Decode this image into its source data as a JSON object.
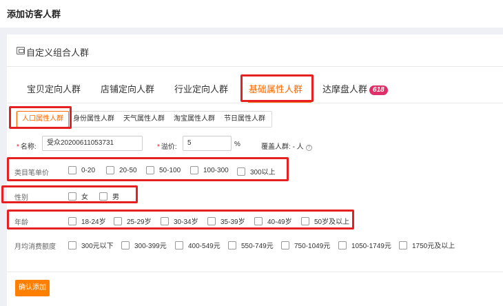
{
  "page": {
    "title": "添加访客人群"
  },
  "card": {
    "title": "自定义组合人群"
  },
  "main_tabs": [
    {
      "label": "宝贝定向人群"
    },
    {
      "label": "店铺定向人群"
    },
    {
      "label": "行业定向人群"
    },
    {
      "label": "基础属性人群",
      "active": true
    },
    {
      "label": "达摩盘人群",
      "badge": "618"
    }
  ],
  "sub_tabs": [
    {
      "label": "人口属性人群",
      "active": true
    },
    {
      "label": "身份属性人群"
    },
    {
      "label": "天气属性人群"
    },
    {
      "label": "淘宝属性人群"
    },
    {
      "label": "节日属性人群"
    }
  ],
  "form": {
    "name_label": "名称:",
    "name_value": "受众20200611053731",
    "premium_label": "溢价:",
    "premium_value": "5",
    "premium_unit": "%",
    "coverage_label": "覆盖人群:",
    "coverage_value": "- 人",
    "help_icon": "?"
  },
  "rows": {
    "category_price": {
      "label": "类目笔单价",
      "options": [
        "0-20",
        "20-50",
        "50-100",
        "100-300",
        "300以上"
      ]
    },
    "gender": {
      "label": "性别",
      "options": [
        "女",
        "男"
      ]
    },
    "age": {
      "label": "年龄",
      "options": [
        "18-24岁",
        "25-29岁",
        "30-34岁",
        "35-39岁",
        "40-49岁",
        "50岁及以上"
      ]
    },
    "monthly_spend": {
      "label": "月均消费额度",
      "options": [
        "300元以下",
        "300-399元",
        "400-549元",
        "550-749元",
        "750-1049元",
        "1050-1749元",
        "1750元及以上"
      ]
    }
  },
  "confirm_button": "确认添加",
  "colors": {
    "accent": "#ff6a00",
    "highlight": "#e62020",
    "badge": "#e0306a"
  }
}
